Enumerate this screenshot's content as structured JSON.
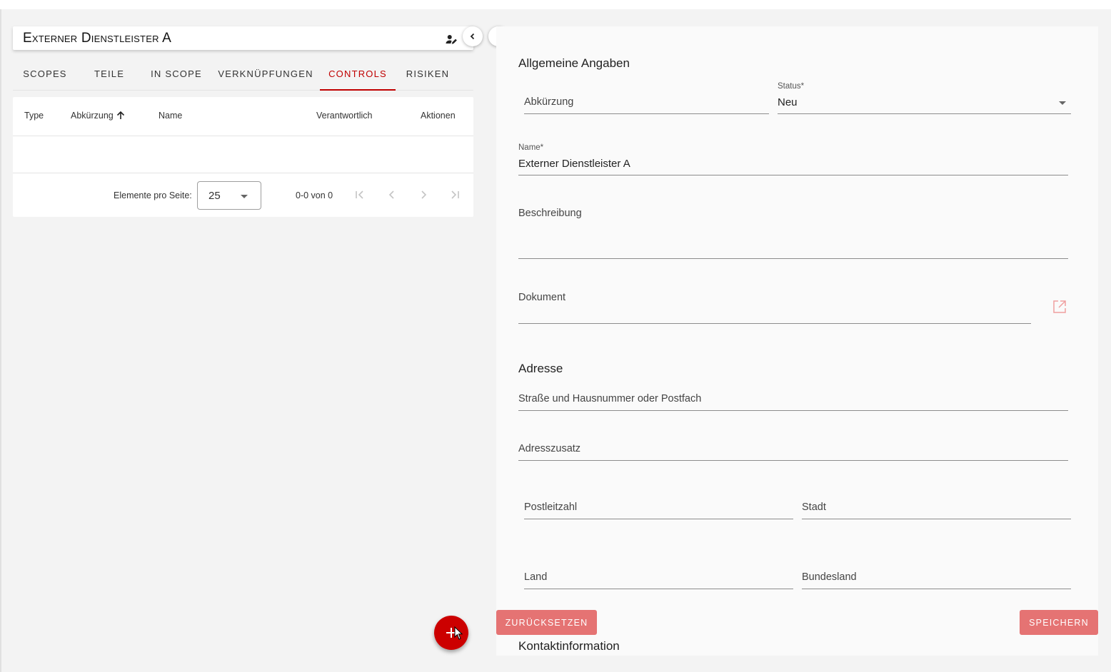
{
  "header": {
    "title": "Externer Dienstleister A"
  },
  "tabs": [
    {
      "label": "Scopes"
    },
    {
      "label": "Teile"
    },
    {
      "label": "In Scope"
    },
    {
      "label": "Verknüpfungen"
    },
    {
      "label": "Controls",
      "active": true
    },
    {
      "label": "Risiken"
    }
  ],
  "table": {
    "columns": [
      "Type",
      "Abkürzung",
      "Name",
      "Verantwortlich",
      "Aktionen"
    ],
    "sorted_column": "Abkürzung",
    "rows": []
  },
  "paginator": {
    "items_per_page_label": "Elemente pro Seite:",
    "items_per_page_value": "25",
    "range_label": "0-0 von 0"
  },
  "form": {
    "general_title": "Allgemeine Angaben",
    "abbreviation_label": "Abkürzung",
    "status_label": "Status*",
    "status_value": "Neu",
    "name_label": "Name*",
    "name_value": "Externer Dienstleister A",
    "description_label": "Beschreibung",
    "document_label": "Dokument",
    "address_title": "Adresse",
    "street_label": "Straße und Hausnummer oder Postfach",
    "address_extra_label": "Adresszusatz",
    "zip_label": "Postleitzahl",
    "city_label": "Stadt",
    "country_label": "Land",
    "state_label": "Bundesland",
    "contact_title": "Kontaktinformation"
  },
  "buttons": {
    "reset": "Zurücksetzen",
    "save": "Speichern"
  },
  "colors": {
    "accent": "#c00000",
    "button": "#e57373",
    "fab": "#cc0000"
  },
  "icons": [
    "edit-user-icon",
    "chevron-left-icon",
    "chevron-right-icon",
    "first-page-icon",
    "prev-page-icon",
    "next-page-icon",
    "last-page-icon",
    "open-in-new-icon",
    "plus-icon"
  ]
}
